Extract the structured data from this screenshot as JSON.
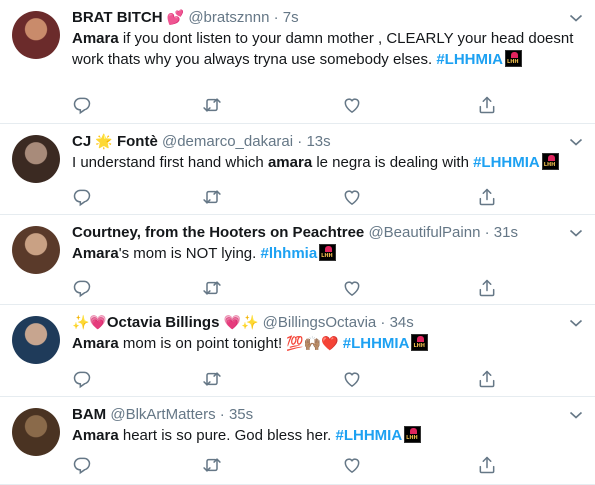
{
  "tweets": [
    {
      "name": "BRAT BITCH",
      "name_emoji": "💕",
      "handle": "@bratsznnn",
      "time": "7s",
      "segments": [
        {
          "t": "Amara",
          "s": "b"
        },
        {
          "t": " if you dont listen to your damn mother , CLEARLY your head doesnt work thats why you always tryna use somebody elses. ",
          "s": ""
        },
        {
          "t": "#LHHMIA",
          "s": "tag"
        }
      ],
      "badge": true,
      "avatar_colors": [
        "#6b2b2b",
        "#c98b6b"
      ]
    },
    {
      "name": "CJ",
      "name_emoji": "🌟",
      "name_suffix": "Fontè",
      "handle": "@demarco_dakarai",
      "time": "13s",
      "segments": [
        {
          "t": "I understand first hand which ",
          "s": ""
        },
        {
          "t": "amara",
          "s": "b"
        },
        {
          "t": " le negra is dealing with ",
          "s": ""
        },
        {
          "t": "#LHHMIA",
          "s": "tag"
        }
      ],
      "badge": true,
      "avatar_colors": [
        "#3b2a22",
        "#a88b7a"
      ]
    },
    {
      "name": "Courtney, from the Hooters on Peachtree",
      "handle": "@BeautifulPainn",
      "time": "31s",
      "segments": [
        {
          "t": "Amara",
          "s": "b"
        },
        {
          "t": "'s mom is NOT lying. ",
          "s": ""
        },
        {
          "t": "#lhhmia",
          "s": "tag"
        }
      ],
      "badge": true,
      "avatar_colors": [
        "#5a3a2a",
        "#c9a184"
      ]
    },
    {
      "name": "Octavia Billings",
      "name_prefix_emoji": "✨💗",
      "name_emoji": "💗✨",
      "handle": "@BillingsOctavia",
      "time": "34s",
      "segments": [
        {
          "t": "Amara",
          "s": "b"
        },
        {
          "t": " mom is on point tonight! ",
          "s": ""
        },
        {
          "t": "💯🙌🏽❤️",
          "s": "emoji"
        },
        {
          "t": " ",
          "s": ""
        },
        {
          "t": "#LHHMIA",
          "s": "tag"
        }
      ],
      "badge": true,
      "avatar_colors": [
        "#1f3b5a",
        "#c7a58f"
      ]
    },
    {
      "name": "BAM",
      "handle": "@BlkArtMatters",
      "time": "35s",
      "segments": [
        {
          "t": "Amara",
          "s": "b"
        },
        {
          "t": " heart is so pure. God bless her. ",
          "s": ""
        },
        {
          "t": "#LHHMIA",
          "s": "tag"
        }
      ],
      "badge": true,
      "avatar_colors": [
        "#4a3322",
        "#8a6a4a"
      ]
    }
  ],
  "separator": "·",
  "badge_text": "LHH",
  "colors": {
    "hashtag": "#1da1f2",
    "muted": "#657786",
    "border": "#e6ecf0",
    "icon": "#657786"
  },
  "icons": [
    "reply-icon",
    "retweet-icon",
    "like-icon",
    "share-icon"
  ]
}
